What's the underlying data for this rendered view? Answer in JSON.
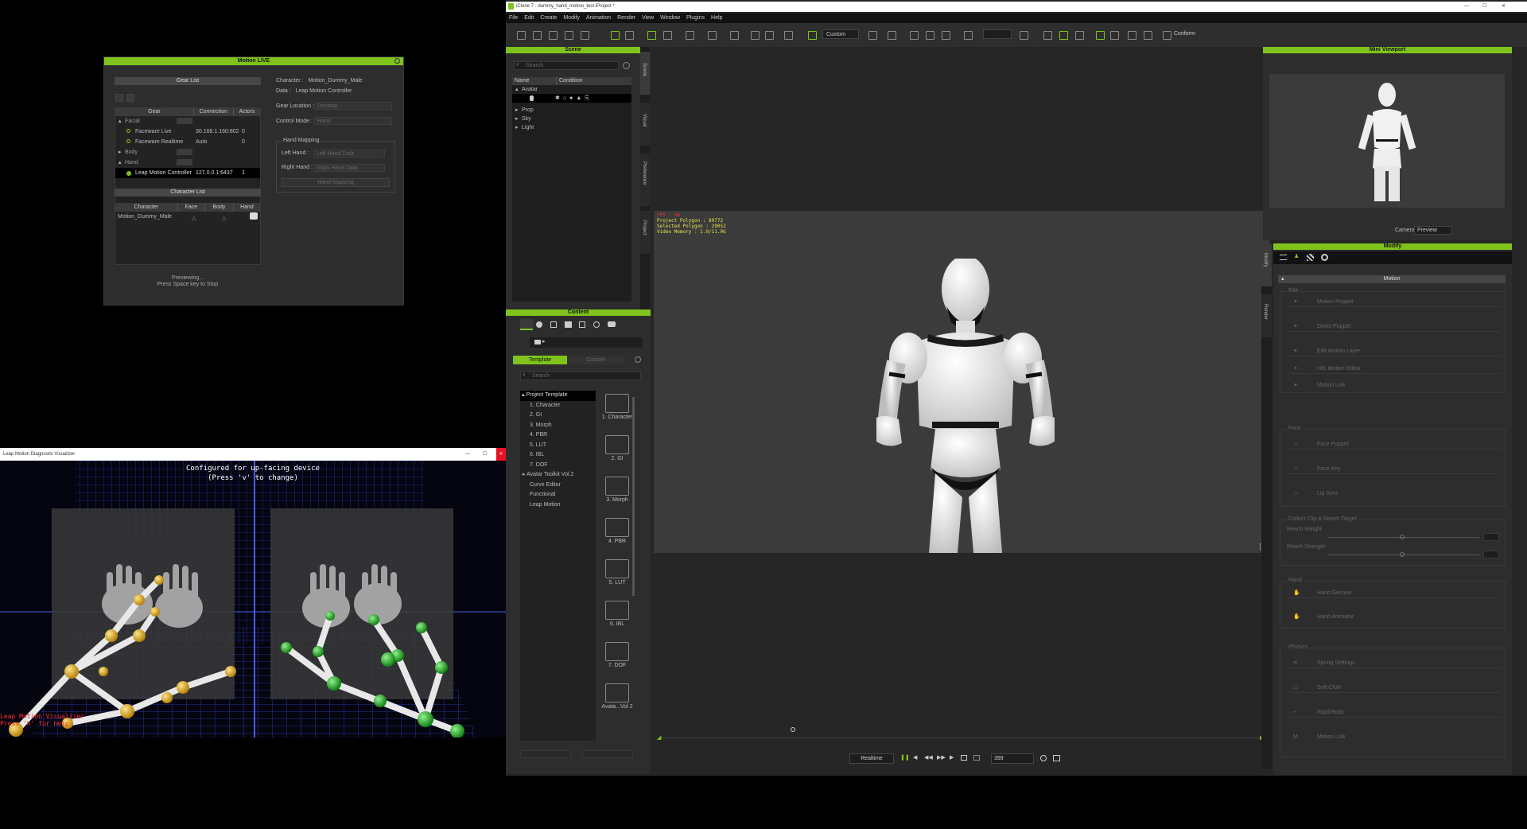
{
  "motion_live": {
    "title": "Motion LIVE",
    "gear_list": {
      "header": "Gear List",
      "columns": [
        "Gear",
        "Connection",
        "Actors"
      ],
      "rows": [
        {
          "name": "Facial",
          "conn": "",
          "actors": "",
          "level": 0
        },
        {
          "name": "Faceware Live",
          "conn": "30.168.1.160:802",
          "actors": "0",
          "level": 1
        },
        {
          "name": "Faceware Realtime",
          "conn": "Auto",
          "actors": "0",
          "level": 1
        },
        {
          "name": "Body",
          "conn": "",
          "actors": "",
          "level": 0
        },
        {
          "name": "Hand",
          "conn": "",
          "actors": "",
          "level": 0
        },
        {
          "name": "Leap Motion Controller",
          "conn": "127.0.0.1:6437",
          "actors": "1",
          "level": 1
        }
      ]
    },
    "character_list": {
      "header": "Character List",
      "columns": [
        "Character",
        "Face",
        "Body",
        "Hand"
      ],
      "rows": [
        {
          "name": "Motion_Dummy_Male"
        }
      ]
    },
    "status_line1": "Previewing...",
    "status_line2": "Press Space key to Stop",
    "char_label": "Character :",
    "char_value": "Motion_Dummy_Male",
    "data_label": "Data :",
    "data_value": "Leap Motion Controller",
    "gear_location_label": "Gear Location :",
    "gear_location_value": "Desktop",
    "control_mode_label": "Control Mode :",
    "control_mode_value": "Hand",
    "hand_mapping_label": "Hand Mapping",
    "left_hand_label": "Left Hand :",
    "left_hand_value": "Left Hand Data",
    "right_hand_label": "Right Hand :",
    "right_hand_value": "Right Hand Data",
    "hand_mapping_button": "Hand Mapping"
  },
  "leap": {
    "title": "Leap Motion Diagnostic Visualizer",
    "config_line1": "Configured for up-facing device",
    "config_line2": "(Press 'v' to change)",
    "overlay_line1": "Leap Motion Visualizer",
    "overlay_line2": "Press 'h' for help"
  },
  "iclone": {
    "title": "iClone 7 - dummy_hand_motion_test.iProject *",
    "menu": [
      "File",
      "Edit",
      "Create",
      "Modify",
      "Animation",
      "Render",
      "View",
      "Window",
      "Plugins",
      "Help"
    ],
    "toolbar": {
      "custom": "Custom",
      "conform": "Conform",
      "preview": "Preview"
    },
    "scene": {
      "title": "Scene",
      "search_placeholder": "Search",
      "columns": [
        "Name",
        "Condition"
      ],
      "items": [
        "Avatar",
        "Prop",
        "Sky",
        "Light"
      ]
    },
    "side_tabs": [
      "Scene",
      "Visual",
      "Preference",
      "Project"
    ],
    "stats": {
      "line1": "FPS : 60",
      "line2": "Project Polygon : 89772",
      "line3": "Selected Polygon : 29052",
      "line4": "Video Memory : 1.0/11.0G"
    },
    "content": {
      "title": "Content",
      "tabs": [
        "Template",
        "Custom"
      ],
      "search_placeholder": "Search",
      "tree": [
        "Project Template",
        "1. Character",
        "2. GI",
        "3. Morph",
        "4. PBR",
        "5. LUT",
        "6. IBL",
        "7. DOF",
        "Avatar Toolkit Vol.2",
        "Curve Editor",
        "Functional",
        "Leap Motion"
      ],
      "thumbs": [
        "1. Character",
        "2. GI",
        "3. Morph",
        "4. PBR",
        "5. LUT",
        "6. IBL",
        "7. DOF",
        "Avata...Vol 2"
      ]
    },
    "mini_viewport": {
      "title": "Mini Viewport",
      "camera_label": "Camera",
      "camera_value": "Preview"
    },
    "modify": {
      "title": "Modify",
      "section": "Motion",
      "side_tabs": [
        "Modify",
        "Render"
      ],
      "group1": "Edit",
      "items1": [
        "Motion Puppet",
        "Direct Puppet",
        "Edit Motion Layer",
        "HIK Motion Editor",
        "Motion Link"
      ],
      "group2": "Face",
      "items2": [
        "Face Puppet",
        "Face Key",
        "Lip Sync"
      ],
      "group3": "Collect Clip & Reach Target",
      "item3a": "Reach Weight",
      "item3b": "Reach Strength",
      "group4": "Hand",
      "items4": [
        "Hand Gesture",
        "Hand Animator"
      ],
      "group5": "Physics",
      "items5": [
        "Spring Settings",
        "Soft Cloth",
        "Rigid Body",
        "Motion Link"
      ]
    },
    "timeline": {
      "realtime": "Realtime",
      "frame": "399"
    }
  },
  "colors": {
    "accent": "#7fc31c",
    "panel": "#2d2d2d",
    "viewport": "#3b3b3b",
    "blue_grid": "#2332a6",
    "joint_yellow": "#e3b019",
    "joint_green": "#1eb71e"
  }
}
